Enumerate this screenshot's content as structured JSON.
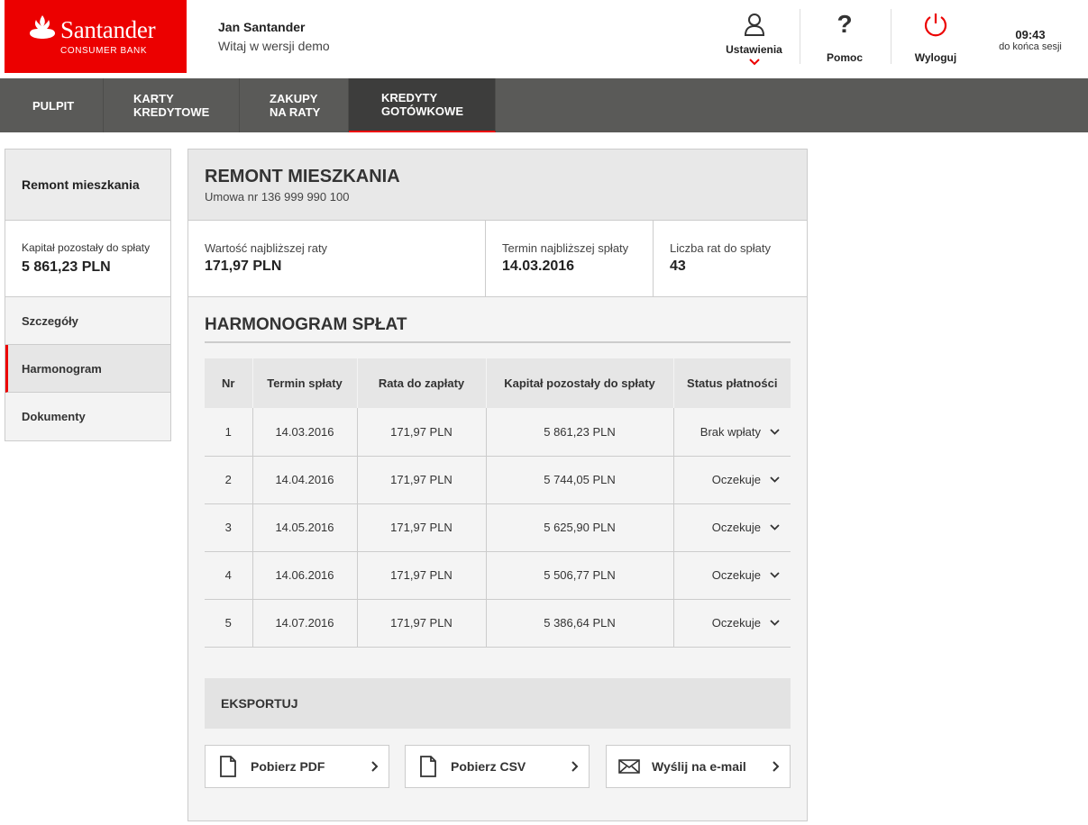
{
  "brand": {
    "name": "Santander",
    "subtitle": "CONSUMER BANK",
    "accent": "#ec0000"
  },
  "user": {
    "name": "Jan Santander",
    "greeting": "Witaj w wersji demo"
  },
  "header_actions": {
    "settings": {
      "label": "Ustawienia",
      "icon": "user-icon"
    },
    "help": {
      "label": "Pomoc",
      "icon": "question-icon"
    },
    "logout": {
      "label": "Wyloguj",
      "icon": "power-icon"
    }
  },
  "session": {
    "time": "09:43",
    "label": "do końca sesji"
  },
  "nav": {
    "items": [
      {
        "line1": "PULPIT",
        "line2": "",
        "active": false
      },
      {
        "line1": "KARTY",
        "line2": "KREDYTOWE",
        "active": false
      },
      {
        "line1": "ZAKUPY",
        "line2": "NA RATY",
        "active": false
      },
      {
        "line1": "KREDYTY",
        "line2": "GOTÓWKOWE",
        "active": true
      }
    ]
  },
  "sidebar": {
    "title": "Remont mieszkania",
    "capital_label": "Kapitał pozostały do spłaty",
    "capital_value": "5 861,23 PLN",
    "items": [
      {
        "label": "Szczegóły",
        "active": false
      },
      {
        "label": "Harmonogram",
        "active": true
      },
      {
        "label": "Dokumenty",
        "active": false
      }
    ]
  },
  "loan": {
    "title": "REMONT MIESZKANIA",
    "contract": "Umowa nr 136 999 990 100",
    "next_installment_label": "Wartość najbliższej raty",
    "next_installment_value": "171,97 PLN",
    "next_due_label": "Termin najbliższej spłaty",
    "next_due_value": "14.03.2016",
    "remaining_count_label": "Liczba rat do spłaty",
    "remaining_count_value": "43"
  },
  "schedule": {
    "title": "HARMONOGRAM SPŁAT",
    "columns": [
      "Nr",
      "Termin spłaty",
      "Rata do zapłaty",
      "Kapitał pozostały do spłaty",
      "Status płatności"
    ],
    "rows": [
      {
        "nr": "1",
        "date": "14.03.2016",
        "amount": "171,97 PLN",
        "capital": "5 861,23 PLN",
        "status": "Brak wpłaty"
      },
      {
        "nr": "2",
        "date": "14.04.2016",
        "amount": "171,97 PLN",
        "capital": "5 744,05 PLN",
        "status": "Oczekuje"
      },
      {
        "nr": "3",
        "date": "14.05.2016",
        "amount": "171,97 PLN",
        "capital": "5 625,90 PLN",
        "status": "Oczekuje"
      },
      {
        "nr": "4",
        "date": "14.06.2016",
        "amount": "171,97 PLN",
        "capital": "5 506,77 PLN",
        "status": "Oczekuje"
      },
      {
        "nr": "5",
        "date": "14.07.2016",
        "amount": "171,97 PLN",
        "capital": "5 386,64 PLN",
        "status": "Oczekuje"
      }
    ]
  },
  "export": {
    "title": "EKSPORTUJ",
    "pdf_label": "Pobierz PDF",
    "csv_label": "Pobierz CSV",
    "email_label": "Wyślij na e-mail"
  }
}
